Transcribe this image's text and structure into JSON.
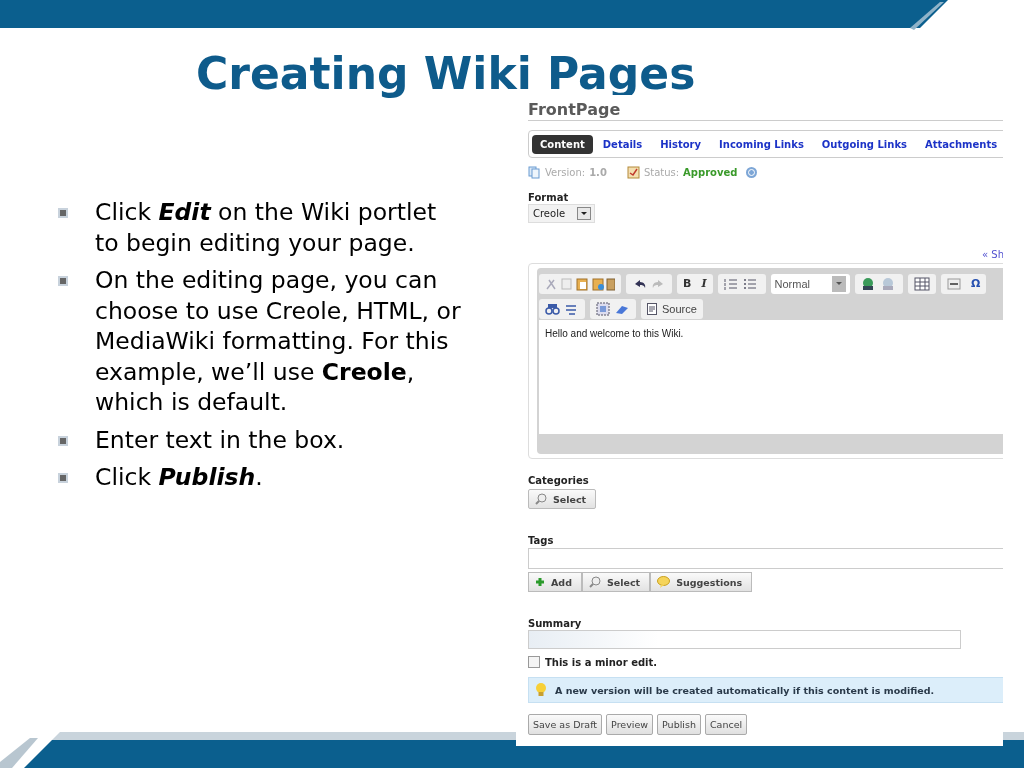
{
  "slide": {
    "title": "Creating Wiki Pages",
    "bullets": [
      "Click *Edit* on the Wiki portlet to begin editing your page.",
      "On the editing page, you can choose to use Creole, HTML, or MediaWiki formatting. For this example, we’ll use **Creole**, which is default.",
      "Enter text in the box.",
      "Click *Publish*."
    ]
  },
  "screenshot": {
    "page_title": "FrontPage",
    "tabs": [
      {
        "label": "Content",
        "selected": true
      },
      {
        "label": "Details",
        "selected": false
      },
      {
        "label": "History",
        "selected": false
      },
      {
        "label": "Incoming Links",
        "selected": false
      },
      {
        "label": "Outgoing Links",
        "selected": false
      },
      {
        "label": "Attachments",
        "selected": false
      }
    ],
    "version_label": "Version:",
    "version": "1.0",
    "status_label": "Status:",
    "status": "Approved",
    "format": {
      "label": "Format",
      "value": "Creole"
    },
    "show_link": "« Sh",
    "editor": {
      "bold": "B",
      "italic": "I",
      "style": "Normal",
      "special_char": "Ω",
      "source": "Source",
      "content": "Hello and welcome to this Wiki."
    },
    "categories": {
      "label": "Categories",
      "button": "Select"
    },
    "tags": {
      "label": "Tags",
      "buttons": [
        "Add",
        "Select",
        "Suggestions"
      ]
    },
    "summary": {
      "label": "Summary"
    },
    "minor_edit": {
      "label": "This is a minor edit.",
      "checked": false
    },
    "info": "A new version will be created automatically if this content is modified.",
    "actions": [
      "Save as Draft",
      "Preview",
      "Publish",
      "Cancel"
    ]
  }
}
